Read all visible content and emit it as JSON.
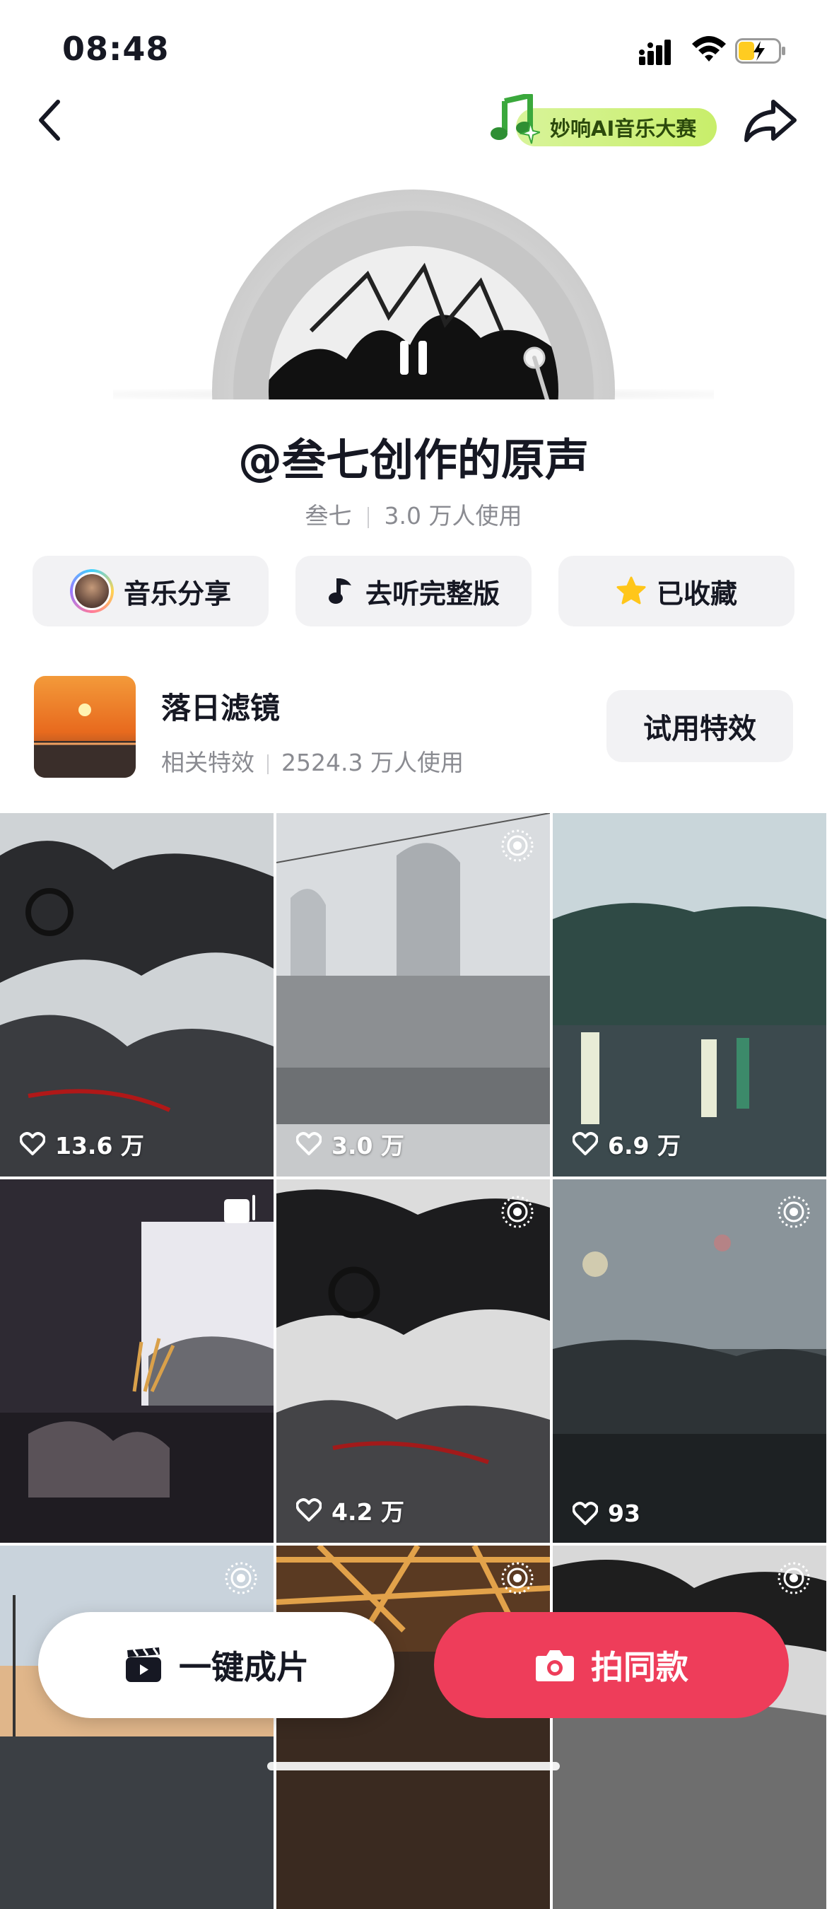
{
  "status_bar": {
    "time": "08:48"
  },
  "header": {
    "contest_label": "妙响AI音乐大赛"
  },
  "sound": {
    "title": "@叁七创作的原声",
    "author": "叁七",
    "usage": "3.0 万人使用"
  },
  "actions": {
    "music_share": "音乐分享",
    "listen_full": "去听完整版",
    "favorited": "已收藏"
  },
  "effect": {
    "name": "落日滤镜",
    "tag": "相关特效",
    "usage": "2524.3 万人使用",
    "try_label": "试用特效"
  },
  "videos": [
    {
      "likes": "13.6 万",
      "icon": "none"
    },
    {
      "likes": "3.0 万",
      "icon": "live-icon"
    },
    {
      "likes": "6.9 万",
      "icon": "none"
    },
    {
      "likes": "",
      "icon": "collection-icon"
    },
    {
      "likes": "4.2 万",
      "icon": "live-icon"
    },
    {
      "likes": "93",
      "icon": "live-icon"
    },
    {
      "likes": "",
      "icon": "live-icon"
    },
    {
      "likes": "",
      "icon": "live-icon"
    },
    {
      "likes": "",
      "icon": "live-icon"
    }
  ],
  "bottom": {
    "one_click_label": "一键成片",
    "shoot_same_label": "拍同款"
  },
  "colors": {
    "accent_red": "#ee3d5a",
    "contest_green": "#c8ee6a",
    "star_yellow": "#ffc61a"
  }
}
